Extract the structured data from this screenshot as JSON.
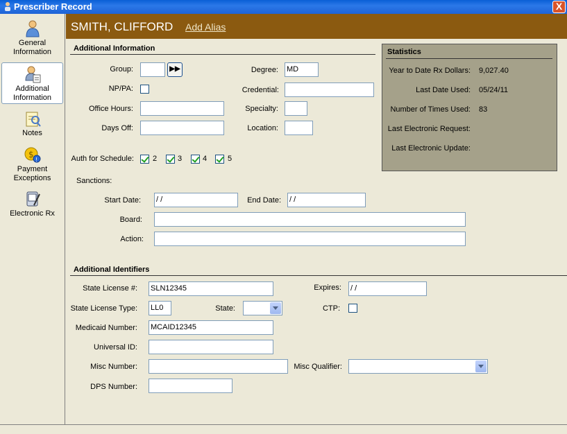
{
  "window": {
    "title": "Prescriber Record",
    "close_label": "X"
  },
  "sidebar": {
    "items": [
      {
        "label_1": "General",
        "label_2": "Information",
        "icon": "person-icon"
      },
      {
        "label_1": "Additional",
        "label_2": "Information",
        "icon": "person-card-icon"
      },
      {
        "label_1": "Notes",
        "label_2": "",
        "icon": "notes-icon"
      },
      {
        "label_1": "Payment",
        "label_2": "Exceptions",
        "icon": "payment-icon"
      },
      {
        "label_1": "Electronic Rx",
        "label_2": "",
        "icon": "electronic-rx-icon"
      }
    ]
  },
  "header": {
    "name": "SMITH, CLIFFORD",
    "add_alias": "Add Alias"
  },
  "additional_info": {
    "title": "Additional Information",
    "group_label": "Group:",
    "group_value": "",
    "group_button": "▶▶",
    "nppa_label": "NP/PA:",
    "office_hours_label": "Office Hours:",
    "office_hours_value": "",
    "days_off_label": "Days Off:",
    "days_off_value": "",
    "degree_label": "Degree:",
    "degree_value": "MD",
    "credential_label": "Credential:",
    "credential_value": "",
    "specialty_label": "Specialty:",
    "specialty_value": "",
    "location_label": "Location:",
    "location_value": "",
    "auth_label": "Auth for Schedule:",
    "schedules": [
      "2",
      "3",
      "4",
      "5"
    ],
    "sanctions_label": "Sanctions:",
    "start_date_label": "Start Date:",
    "start_date_value": " / /",
    "end_date_label": "End Date:",
    "end_date_value": " / /",
    "board_label": "Board:",
    "board_value": "",
    "action_label": "Action:",
    "action_value": ""
  },
  "statistics": {
    "title": "Statistics",
    "ytd_label": "Year to Date Rx Dollars:",
    "ytd_value": "9,027.40",
    "last_used_label": "Last Date Used:",
    "last_used_value": "05/24/11",
    "times_used_label": "Number of Times Used:",
    "times_used_value": "83",
    "last_req_label": "Last Electronic Request:",
    "last_req_value": "",
    "last_upd_label": "Last Electronic Update:",
    "last_upd_value": ""
  },
  "identifiers": {
    "title": "Additional Identifiers",
    "state_license_label": "State License #:",
    "state_license_value": "SLN12345",
    "expires_label": "Expires:",
    "expires_value": " / /",
    "license_type_label": "State License Type:",
    "license_type_value": "LL0",
    "state_label": "State:",
    "state_value": "",
    "ctp_label": "CTP:",
    "medicaid_label": "Medicaid Number:",
    "medicaid_value": "MCAID12345",
    "universal_label": "Universal ID:",
    "universal_value": "",
    "misc_number_label": "Misc Number:",
    "misc_number_value": "",
    "misc_qualifier_label": "Misc Qualifier:",
    "misc_qualifier_value": "",
    "dps_label": "DPS Number:",
    "dps_value": ""
  },
  "colors": {
    "header_bg": "#8b5a10",
    "stats_bg": "#a5a18a",
    "window_bg": "#ece9d8",
    "titlebar": "#1f63d6",
    "check": "#21a121"
  }
}
